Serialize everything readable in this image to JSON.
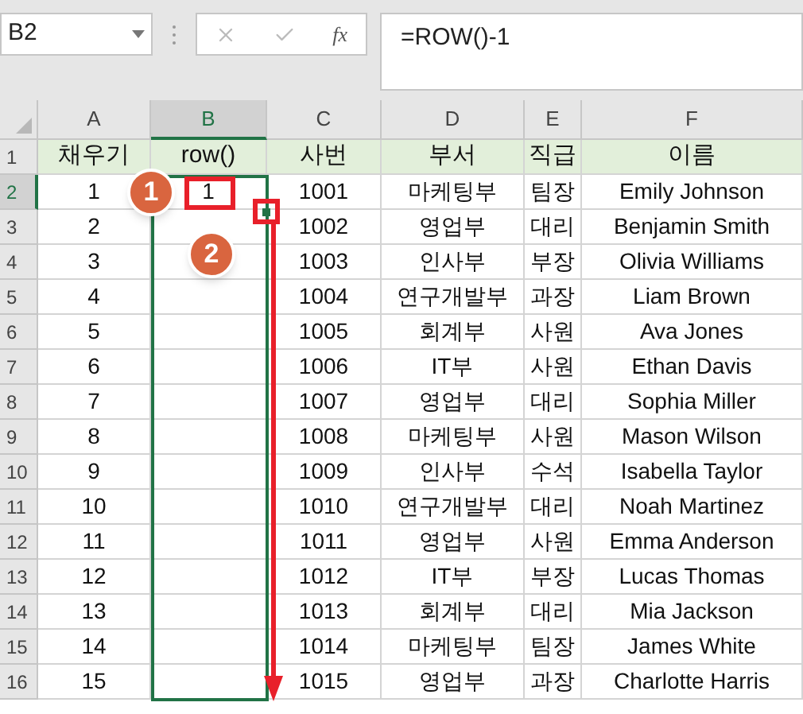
{
  "name_box": "B2",
  "fx_label": "fx",
  "formula": "=ROW()-1",
  "columns": [
    {
      "label": "A",
      "selected": false
    },
    {
      "label": "B",
      "selected": true
    },
    {
      "label": "C",
      "selected": false
    },
    {
      "label": "D",
      "selected": false
    },
    {
      "label": "E",
      "selected": false
    },
    {
      "label": "F",
      "selected": false
    }
  ],
  "rows": [
    {
      "number": "1",
      "selected": false,
      "header": true,
      "cells": [
        "채우기",
        "row()",
        "사번",
        "부서",
        "직급",
        "이름"
      ]
    },
    {
      "number": "2",
      "selected": true,
      "header": false,
      "cells": [
        "1",
        "1",
        "1001",
        "마케팅부",
        "팀장",
        "Emily Johnson"
      ]
    },
    {
      "number": "3",
      "selected": false,
      "header": false,
      "cells": [
        "2",
        "",
        "1002",
        "영업부",
        "대리",
        "Benjamin Smith"
      ]
    },
    {
      "number": "4",
      "selected": false,
      "header": false,
      "cells": [
        "3",
        "",
        "1003",
        "인사부",
        "부장",
        "Olivia Williams"
      ]
    },
    {
      "number": "5",
      "selected": false,
      "header": false,
      "cells": [
        "4",
        "",
        "1004",
        "연구개발부",
        "과장",
        "Liam Brown"
      ]
    },
    {
      "number": "6",
      "selected": false,
      "header": false,
      "cells": [
        "5",
        "",
        "1005",
        "회계부",
        "사원",
        "Ava Jones"
      ]
    },
    {
      "number": "7",
      "selected": false,
      "header": false,
      "cells": [
        "6",
        "",
        "1006",
        "IT부",
        "사원",
        "Ethan Davis"
      ]
    },
    {
      "number": "8",
      "selected": false,
      "header": false,
      "cells": [
        "7",
        "",
        "1007",
        "영업부",
        "대리",
        "Sophia Miller"
      ]
    },
    {
      "number": "9",
      "selected": false,
      "header": false,
      "cells": [
        "8",
        "",
        "1008",
        "마케팅부",
        "사원",
        "Mason Wilson"
      ]
    },
    {
      "number": "10",
      "selected": false,
      "header": false,
      "cells": [
        "9",
        "",
        "1009",
        "인사부",
        "수석",
        "Isabella Taylor"
      ]
    },
    {
      "number": "11",
      "selected": false,
      "header": false,
      "cells": [
        "10",
        "",
        "1010",
        "연구개발부",
        "대리",
        "Noah Martinez"
      ]
    },
    {
      "number": "12",
      "selected": false,
      "header": false,
      "cells": [
        "11",
        "",
        "1011",
        "영업부",
        "사원",
        "Emma Anderson"
      ]
    },
    {
      "number": "13",
      "selected": false,
      "header": false,
      "cells": [
        "12",
        "",
        "1012",
        "IT부",
        "부장",
        "Lucas Thomas"
      ]
    },
    {
      "number": "14",
      "selected": false,
      "header": false,
      "cells": [
        "13",
        "",
        "1013",
        "회계부",
        "대리",
        "Mia Jackson"
      ]
    },
    {
      "number": "15",
      "selected": false,
      "header": false,
      "cells": [
        "14",
        "",
        "1014",
        "마케팅부",
        "팀장",
        "James White"
      ]
    },
    {
      "number": "16",
      "selected": false,
      "header": false,
      "cells": [
        "15",
        "",
        "1015",
        "영업부",
        "과장",
        "Charlotte Harris"
      ]
    }
  ],
  "callouts": [
    {
      "label": "1"
    },
    {
      "label": "2"
    }
  ]
}
